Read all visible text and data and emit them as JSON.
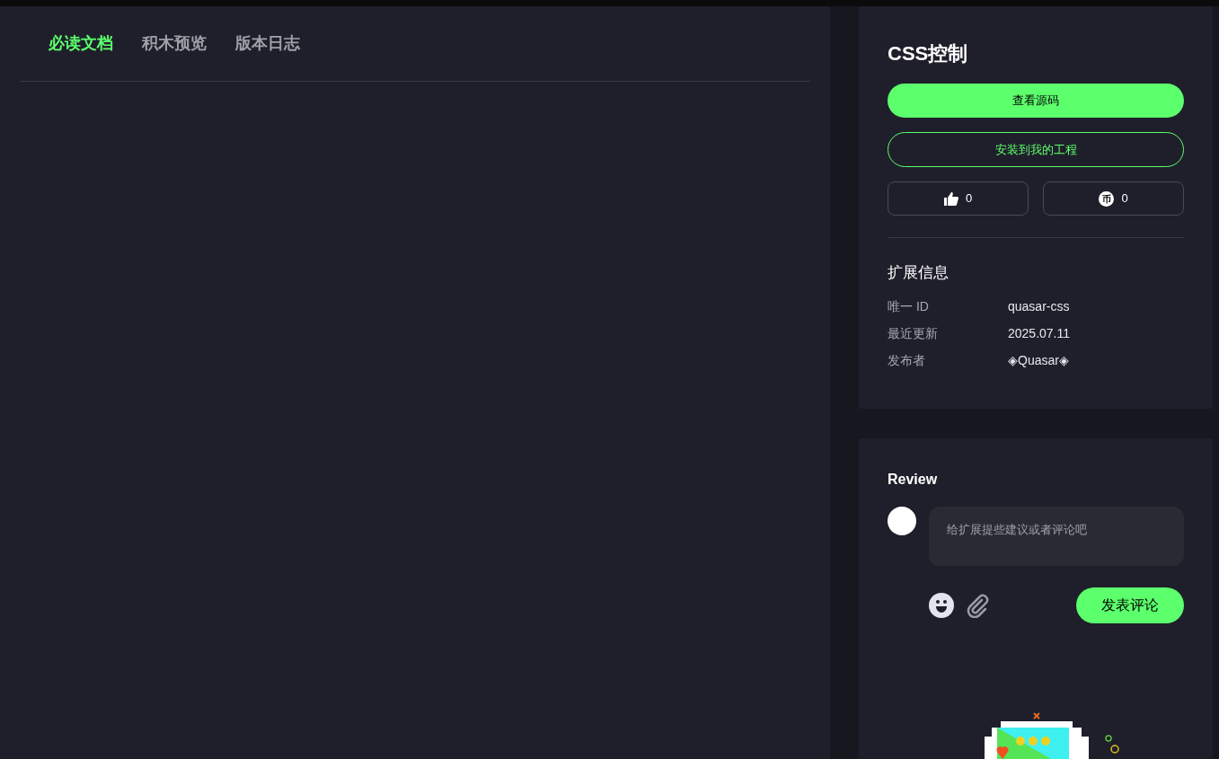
{
  "tabs": [
    {
      "label": "必读文档",
      "selected": true
    },
    {
      "label": "积木预览",
      "selected": false
    },
    {
      "label": "版本日志",
      "selected": false
    }
  ],
  "extension": {
    "title": "CSS控制",
    "view_source": "查看源码",
    "install": "安装到我的工程",
    "likes": "0",
    "coins": "0",
    "coin_glyph": "币"
  },
  "info": {
    "title": "扩展信息",
    "rows": [
      {
        "label": "唯一 ID",
        "value": "quasar-css"
      },
      {
        "label": "最近更新",
        "value": "2025.07.11"
      },
      {
        "label": "发布者",
        "value": "◈Quasar◈"
      }
    ]
  },
  "review": {
    "title": "Review",
    "placeholder": "给扩展提些建议或者评论吧",
    "submit": "发表评论"
  }
}
